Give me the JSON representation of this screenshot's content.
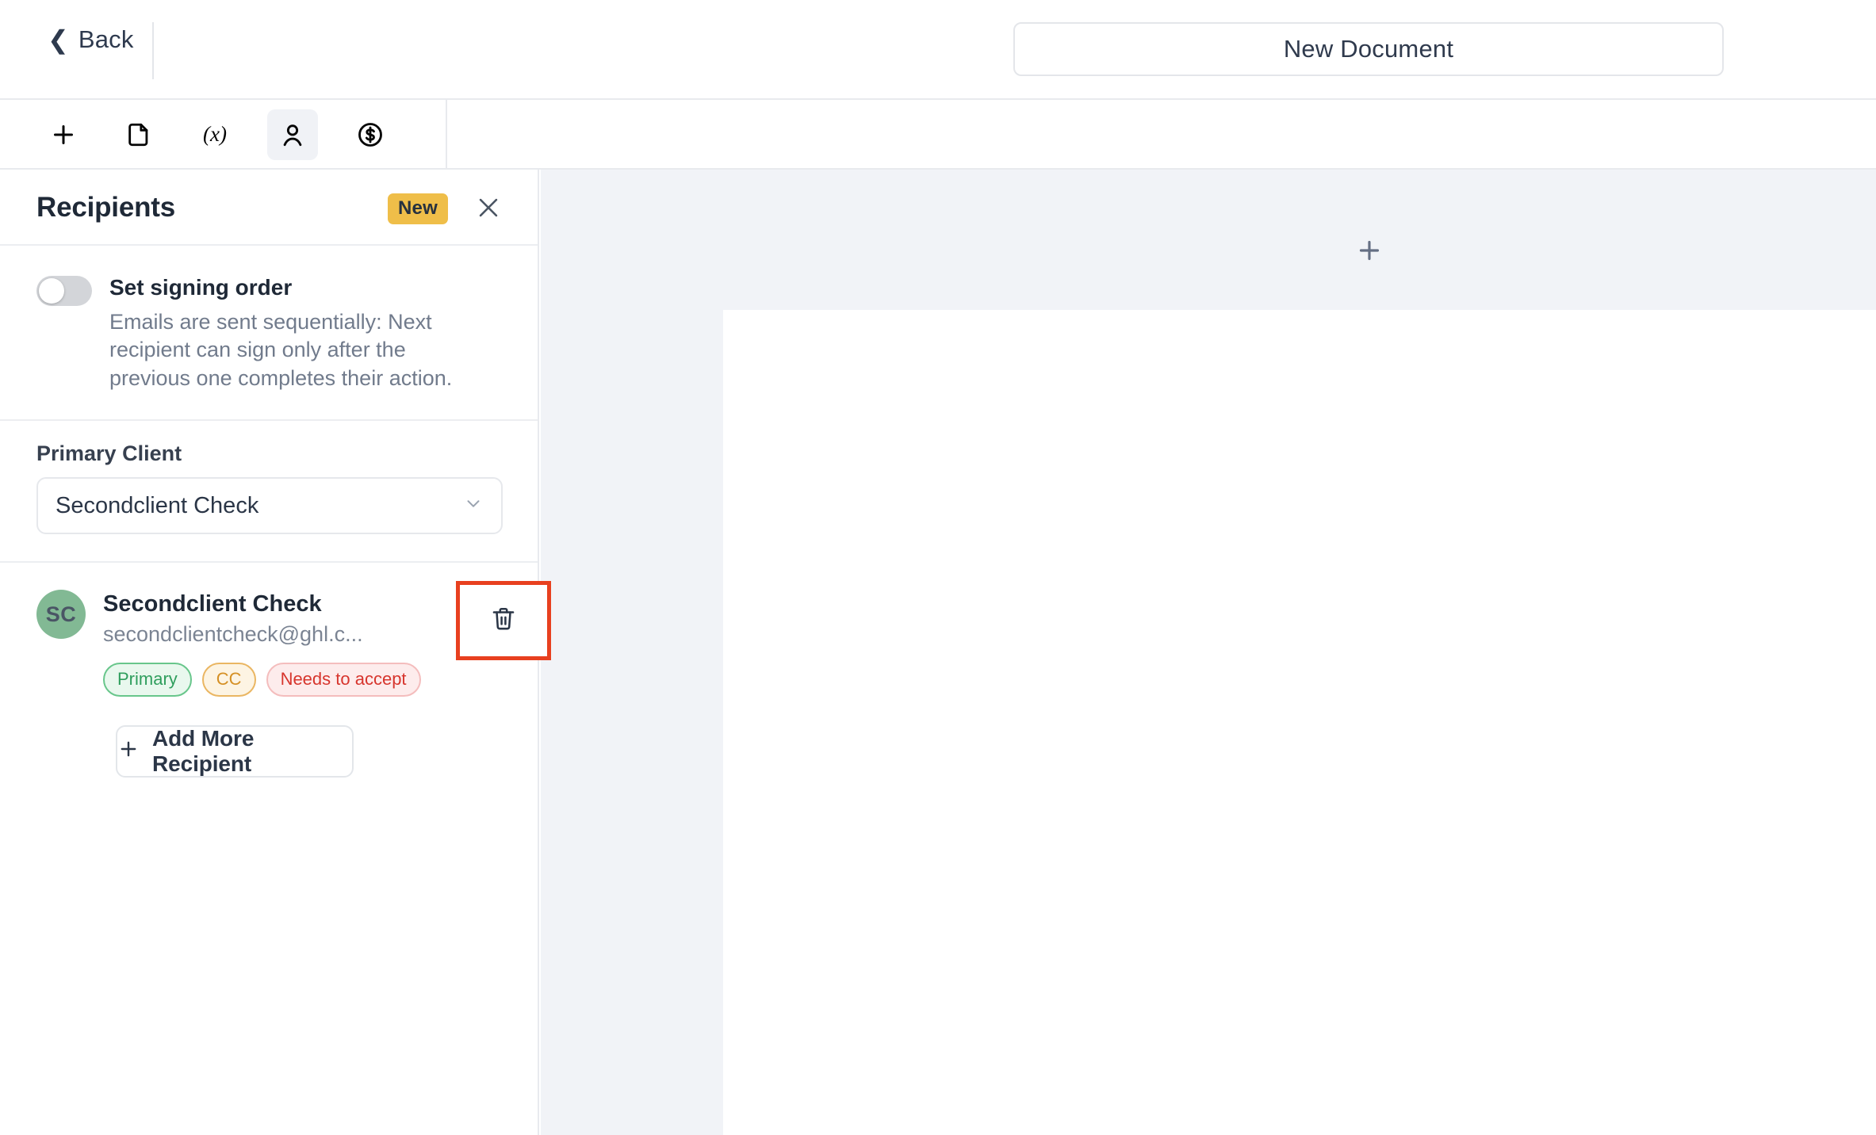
{
  "topbar": {
    "back_label": "Back",
    "back_icon": "chevron-left-icon",
    "document_title": "New Document"
  },
  "toolbar": {
    "items": [
      {
        "name": "add-element",
        "icon": "plus-icon",
        "active": false
      },
      {
        "name": "document",
        "icon": "file-icon",
        "active": false
      },
      {
        "name": "variable",
        "icon": "variable-x-icon",
        "active": false
      },
      {
        "name": "recipients",
        "icon": "person-icon",
        "active": true
      },
      {
        "name": "payment",
        "icon": "dollar-circle-icon",
        "active": false
      }
    ],
    "new_badge": "New"
  },
  "panel": {
    "title": "Recipients",
    "close_icon": "close-icon",
    "signing_order": {
      "label": "Set signing order",
      "description": "Emails are sent sequentially: Next recipient can sign only after the previous one completes their action.",
      "enabled": false
    },
    "primary_client": {
      "label": "Primary Client",
      "value": "Secondclient Check",
      "chevron_icon": "chevron-down-icon"
    },
    "recipients": [
      {
        "initials": "SC",
        "avatar_color": "#82b994",
        "name": "Secondclient Check",
        "email": "secondclientcheck@ghl.c...",
        "badges": [
          {
            "label": "Primary",
            "color": "#2f9e5d"
          },
          {
            "label": "CC",
            "color": "#d59024"
          },
          {
            "label": "Needs to accept",
            "color": "#d7352d"
          }
        ],
        "delete_icon": "trash-icon"
      }
    ],
    "add_recipient_label": "Add More Recipient",
    "add_recipient_icon": "plus-icon"
  },
  "canvas": {
    "add_page_icon": "plus-icon",
    "background_color": "#f1f3f7",
    "page_color": "#ffffff"
  },
  "highlight": {
    "color": "#e8401f",
    "target": "delete-recipient-button"
  }
}
